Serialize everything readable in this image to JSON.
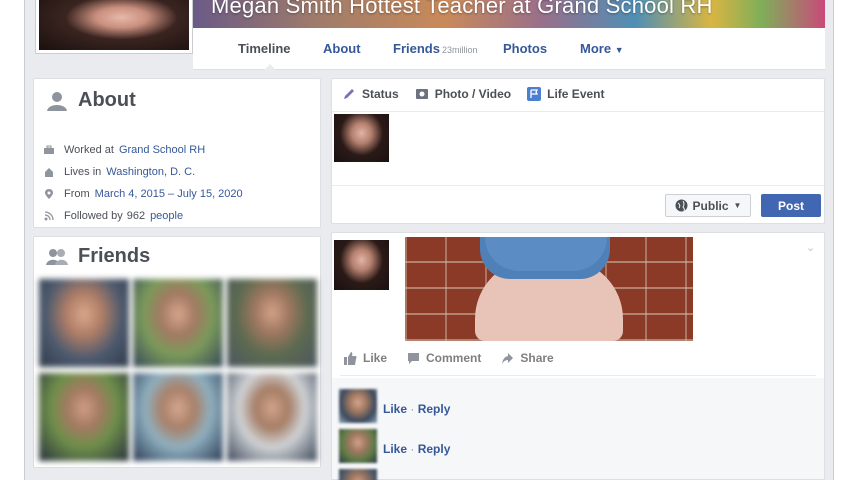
{
  "cover": {
    "title": "Megan Smith Hottest Teacher at Grand School RH"
  },
  "nav": {
    "tabs": [
      {
        "label": "Timeline"
      },
      {
        "label": "About"
      },
      {
        "label": "Friends",
        "count": "23million"
      },
      {
        "label": "Photos"
      },
      {
        "label": "More"
      }
    ]
  },
  "about": {
    "heading": "About",
    "items": [
      {
        "icon": "briefcase-icon",
        "prefix": "Worked at",
        "value": "Grand School RH"
      },
      {
        "icon": "house-icon",
        "prefix": "Lives in",
        "value": "Washington, D. C."
      },
      {
        "icon": "location-pin-icon",
        "prefix": "From",
        "value": "March 4, 2015 – July 15, 2020"
      },
      {
        "icon": "rss-icon",
        "prefix": "Followed by",
        "count": "962",
        "value": "people"
      }
    ]
  },
  "friends": {
    "heading": "Friends"
  },
  "composer": {
    "actions": [
      {
        "icon": "pencil-icon",
        "label": "Status"
      },
      {
        "icon": "camera-icon",
        "label": "Photo / Video"
      },
      {
        "icon": "flag-icon",
        "label": "Life Event"
      }
    ],
    "privacy": "Public",
    "post_label": "Post"
  },
  "post": {
    "actions": [
      {
        "icon": "thumbs-up-icon",
        "label": "Like"
      },
      {
        "icon": "comment-icon",
        "label": "Comment"
      },
      {
        "icon": "share-icon",
        "label": "Share"
      }
    ],
    "comments": [
      {
        "like": "Like",
        "sep": "·",
        "reply": "Reply"
      },
      {
        "like": "Like",
        "sep": "·",
        "reply": "Reply"
      }
    ]
  },
  "colors": {
    "link": "#365899",
    "primary_button": "#4267b2",
    "page_background": "#e9ebee"
  }
}
